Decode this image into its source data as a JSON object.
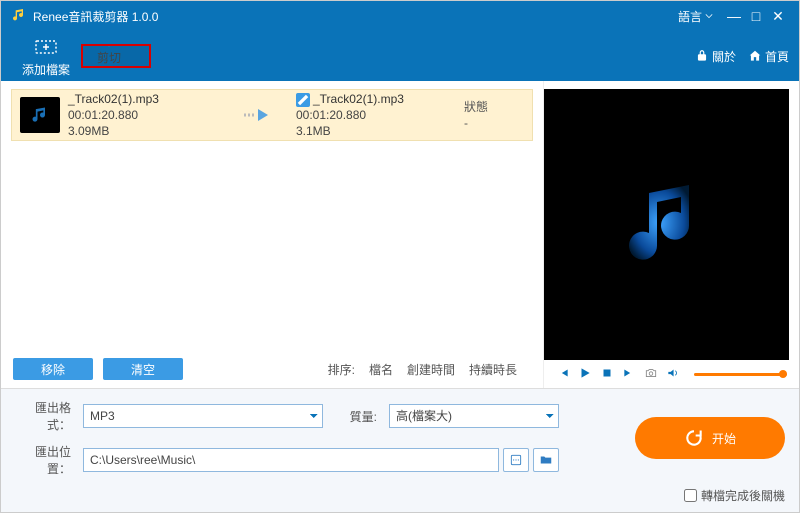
{
  "titlebar": {
    "title": "Renee音訊裁剪器 1.0.0",
    "language": "語言"
  },
  "toolbar": {
    "add_file": "添加檔案",
    "cut": "剪切",
    "about": "關於",
    "home": "首頁"
  },
  "filelist": {
    "item": {
      "src_name": "_Track02(1).mp3",
      "src_duration": "00:01:20.880",
      "src_size": "3.09MB",
      "out_name": "_Track02(1).mp3",
      "out_duration": "00:01:20.880",
      "out_size": "3.1MB",
      "status_header": "狀態",
      "status_value": "-"
    }
  },
  "listbuttons": {
    "remove": "移除",
    "clear": "清空"
  },
  "sort": {
    "label": "排序:",
    "by_name": "檔名",
    "by_created": "創建時間",
    "by_duration": "持續時長"
  },
  "bottom": {
    "format_label": "匯出格式：",
    "format_value": "MP3",
    "quality_label": "質量:",
    "quality_value": "高(檔案大)",
    "path_label": "匯出位置：",
    "path_value": "C:\\Users\\ree\\Music\\",
    "start": "开始",
    "shutdown_label": "轉檔完成後關機"
  }
}
